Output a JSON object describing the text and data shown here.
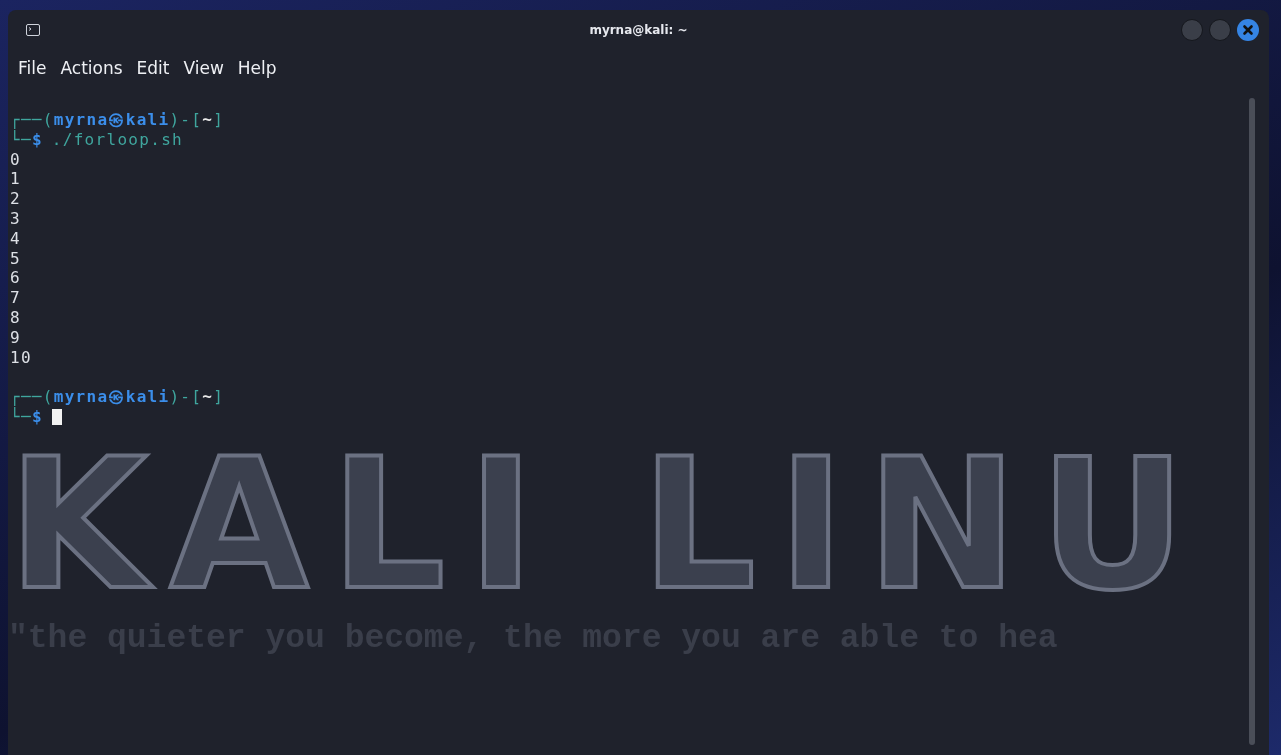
{
  "window": {
    "title": "myrna@kali: ~"
  },
  "menu": [
    "File",
    "Actions",
    "Edit",
    "View",
    "Help"
  ],
  "terminal": {
    "lines": [
      {
        "kind": "prompt",
        "open": "┌──(",
        "user_host": "myrna㉿kali",
        "mid": ")-[",
        "dir": "~",
        "close": "]",
        "corner": "└─",
        "symbol": "$",
        "command": "./forloop.sh",
        "cursor": false
      },
      {
        "kind": "output",
        "text": "0"
      },
      {
        "kind": "output",
        "text": "1"
      },
      {
        "kind": "output",
        "text": "2"
      },
      {
        "kind": "output",
        "text": "3"
      },
      {
        "kind": "output",
        "text": "4"
      },
      {
        "kind": "output",
        "text": "5"
      },
      {
        "kind": "output",
        "text": "6"
      },
      {
        "kind": "output",
        "text": "7"
      },
      {
        "kind": "output",
        "text": "8"
      },
      {
        "kind": "output",
        "text": "9"
      },
      {
        "kind": "output",
        "text": "10"
      },
      {
        "kind": "blank"
      },
      {
        "kind": "prompt",
        "open": "┌──(",
        "user_host": "myrna㉿kali",
        "mid": ")-[",
        "dir": "~",
        "close": "]",
        "corner": "└─",
        "symbol": "$",
        "cursor": true
      }
    ]
  },
  "wallpaper": {
    "logo": "KALI LINU",
    "motto": "\"the quieter you become, the more you are able to hea"
  }
}
